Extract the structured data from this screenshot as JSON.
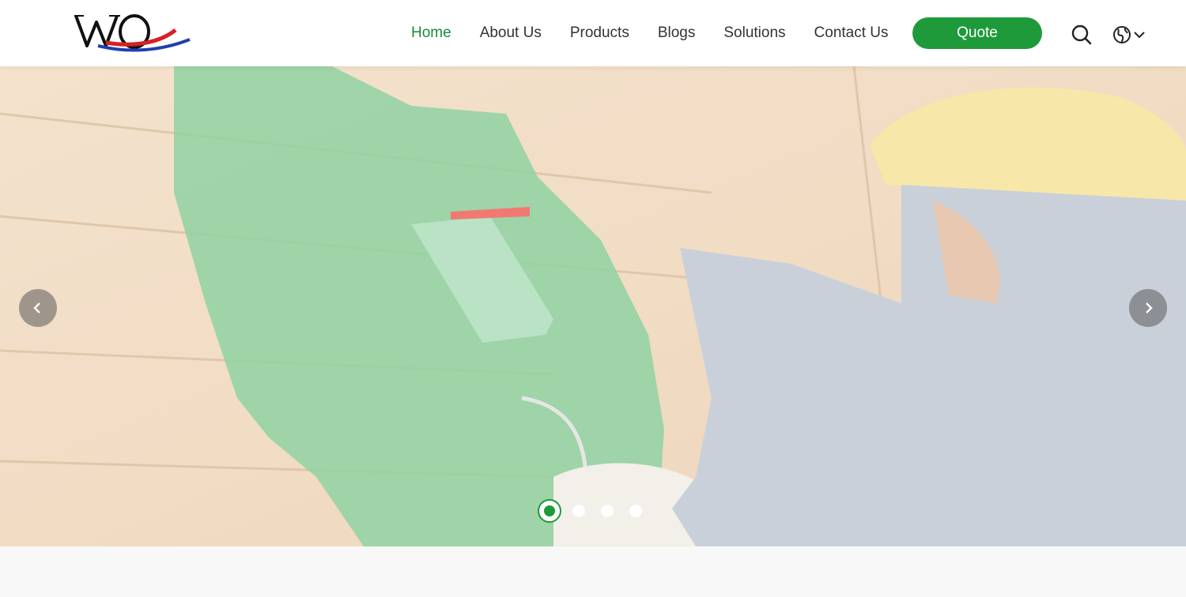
{
  "header": {
    "logo_text": "WQ",
    "nav": [
      {
        "label": "Home",
        "active": true
      },
      {
        "label": "About Us",
        "active": false
      },
      {
        "label": "Products",
        "active": false
      },
      {
        "label": "Blogs",
        "active": false
      },
      {
        "label": "Solutions",
        "active": false
      },
      {
        "label": "Contact Us",
        "active": false
      }
    ],
    "quote_label": "Quote",
    "search_icon": "search-icon",
    "language_icon": "globe-icon"
  },
  "hero": {
    "slide_count": 4,
    "active_slide": 1,
    "prev_icon": "chevron-left-icon",
    "next_icon": "chevron-right-icon"
  },
  "colors": {
    "accent": "#1e9a3a",
    "nav_active": "#1a8a3a",
    "text": "#333333"
  }
}
